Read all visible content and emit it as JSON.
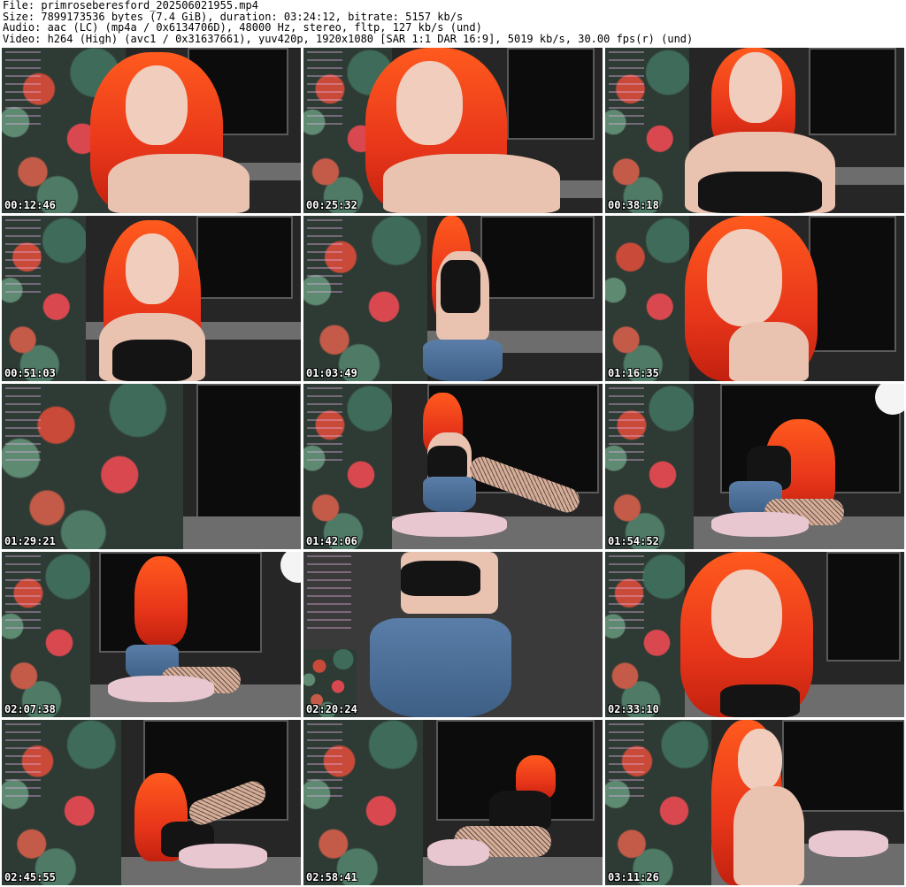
{
  "header": {
    "file_line": "File: primroseberesford_202506021955.mp4",
    "size_line": "Size: 7899173536 bytes (7.4 GiB), duration: 03:24:12, bitrate: 5157 kb/s",
    "audio_line": "Audio: aac (LC) (mp4a / 0x6134706D), 48000 Hz, stereo, fltp, 127 kb/s (und)",
    "video_line": "Video: h264 (High) (avc1 / 0x31637661), yuv420p, 1920x1080 [SAR 1:1 DAR 16:9], 5019 kb/s, 30.00 fps(r) (und)"
  },
  "thumbnails": [
    {
      "timestamp": "00:12:46"
    },
    {
      "timestamp": "00:25:32"
    },
    {
      "timestamp": "00:38:18"
    },
    {
      "timestamp": "00:51:03"
    },
    {
      "timestamp": "01:03:49"
    },
    {
      "timestamp": "01:16:35"
    },
    {
      "timestamp": "01:29:21"
    },
    {
      "timestamp": "01:42:06"
    },
    {
      "timestamp": "01:54:52"
    },
    {
      "timestamp": "02:07:38"
    },
    {
      "timestamp": "02:20:24"
    },
    {
      "timestamp": "02:33:10"
    },
    {
      "timestamp": "02:45:55"
    },
    {
      "timestamp": "02:58:41"
    },
    {
      "timestamp": "03:11:26"
    }
  ]
}
